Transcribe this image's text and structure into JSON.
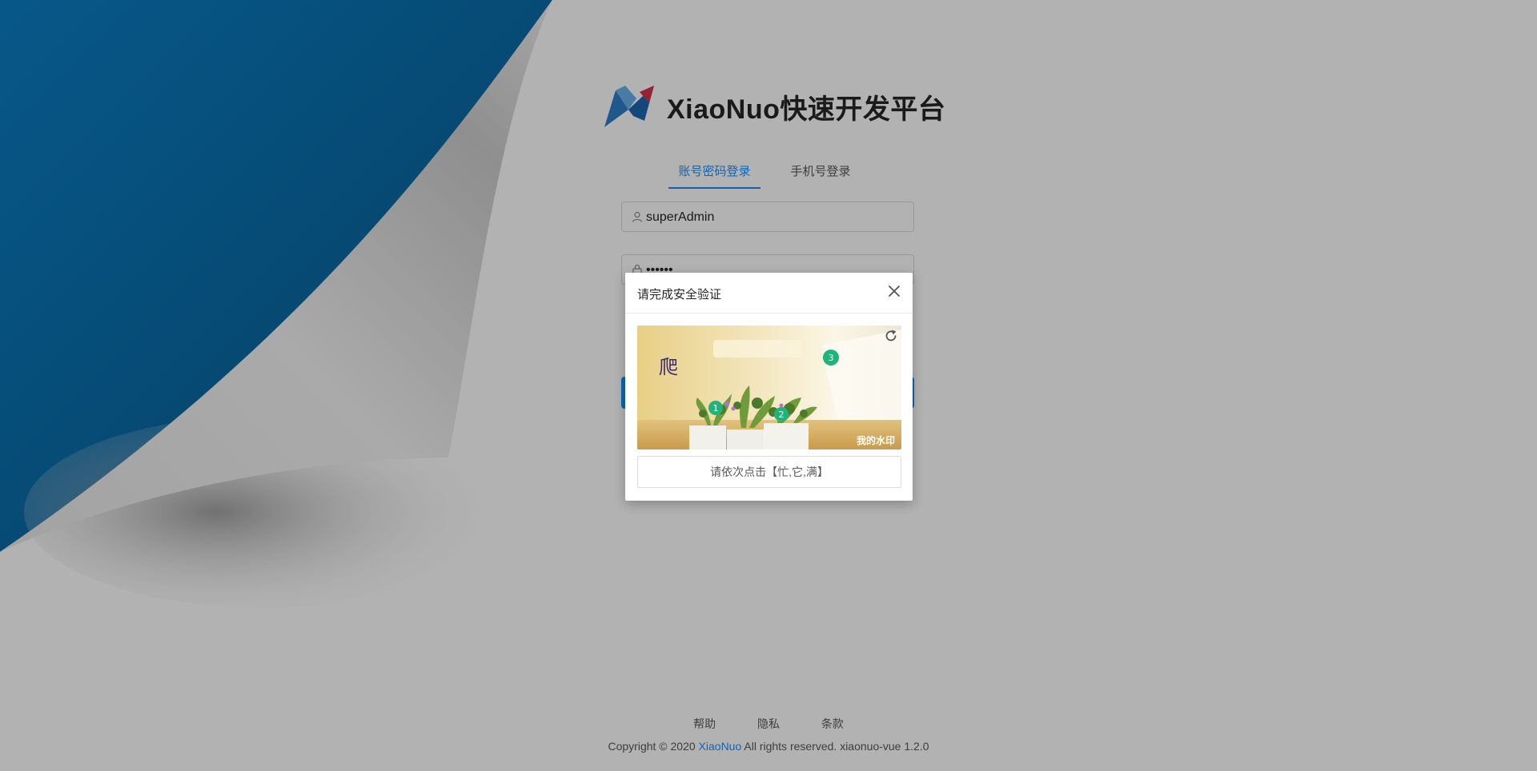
{
  "brand": {
    "title": "XiaoNuo快速开发平台"
  },
  "tabs": [
    {
      "label": "账号密码登录",
      "active": true
    },
    {
      "label": "手机号登录",
      "active": false
    }
  ],
  "form": {
    "username": {
      "value": "superAdmin",
      "icon": "user-icon"
    },
    "password": {
      "value": "••••••",
      "icon": "lock-icon"
    }
  },
  "footer": {
    "links": [
      "帮助",
      "隐私",
      "条款"
    ],
    "copyright_prefix": "Copyright © 2020 ",
    "copyright_link": "XiaoNuo",
    "copyright_suffix": " All rights reserved. xiaonuo-vue 1.2.0"
  },
  "modal": {
    "title": "请完成安全验证",
    "close_icon": "close-icon",
    "refresh_icon": "refresh-icon",
    "hint": "请依次点击【忙,它,满】",
    "captcha": {
      "char_shown": "爬",
      "watermark": "我的水印",
      "markers": [
        "1",
        "2",
        "3"
      ]
    }
  },
  "colors": {
    "accent": "#1890ff",
    "marker": "#1fb47a",
    "overlay": "rgba(0,0,0,0.30)",
    "corner": "#0a6fb0"
  }
}
